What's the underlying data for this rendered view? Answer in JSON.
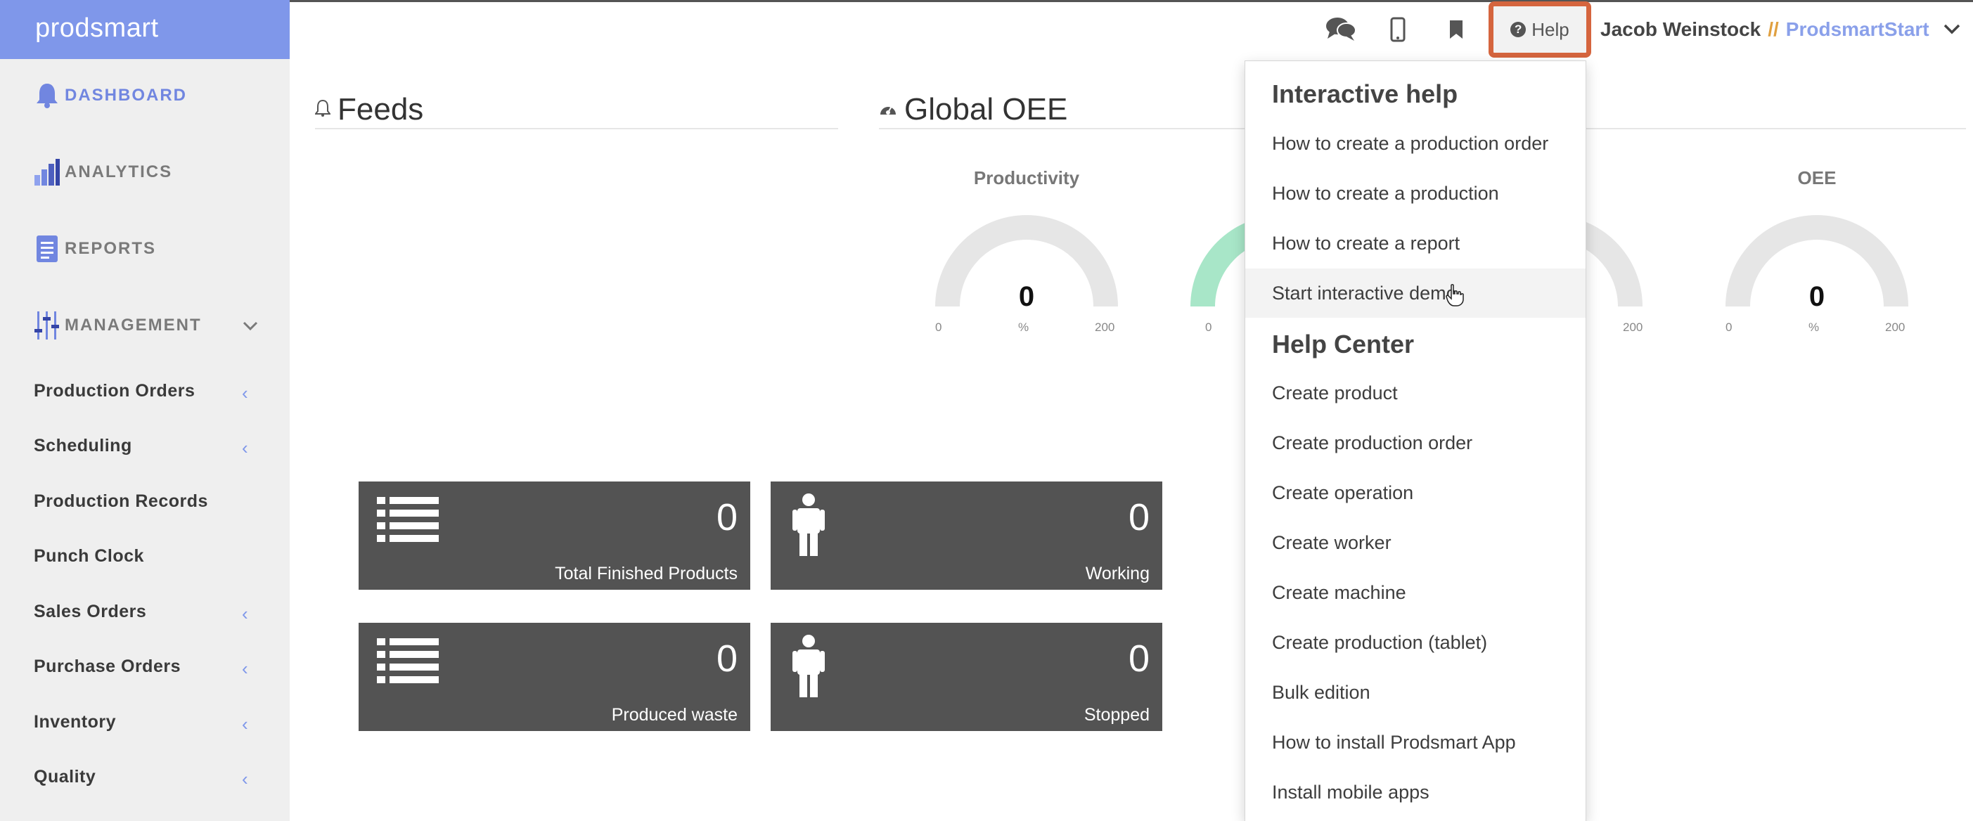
{
  "sidebar": {
    "brand": "prodsmart",
    "main_items": [
      {
        "label": "DASHBOARD",
        "icon": "bell-icon",
        "active": true
      },
      {
        "label": "ANALYTICS",
        "icon": "bar-chart-icon",
        "active": false
      },
      {
        "label": "REPORTS",
        "icon": "report-icon",
        "active": false
      },
      {
        "label": "MANAGEMENT",
        "icon": "sliders-icon",
        "active": false
      }
    ],
    "sub_items": [
      {
        "label": "Production Orders",
        "has_chevron": true
      },
      {
        "label": "Scheduling",
        "has_chevron": true
      },
      {
        "label": "Production Records",
        "has_chevron": false
      },
      {
        "label": "Punch Clock",
        "has_chevron": false
      },
      {
        "label": "Sales Orders",
        "has_chevron": true
      },
      {
        "label": "Purchase Orders",
        "has_chevron": true
      },
      {
        "label": "Inventory",
        "has_chevron": true
      },
      {
        "label": "Quality",
        "has_chevron": true
      }
    ]
  },
  "topbar": {
    "icons": [
      "chat-icon",
      "mobile-icon",
      "bookmark-icon"
    ],
    "help_label": "Help",
    "user_name": "Jacob Weinstock",
    "separator": "//",
    "company": "ProdsmartStart"
  },
  "feeds": {
    "title": "Feeds"
  },
  "oee": {
    "title": "Global OEE",
    "gauges": [
      {
        "title": "Productivity",
        "value": "0",
        "min": "0",
        "max": "200",
        "unit": "%"
      },
      {
        "title": "OEE",
        "value": "0",
        "min": "0",
        "max": "200",
        "unit": "%"
      }
    ],
    "partial": {
      "min": "0",
      "max_right": "200"
    }
  },
  "tiles": [
    {
      "value": "0",
      "label": "Total Finished Products",
      "icon": "list-icon"
    },
    {
      "value": "0",
      "label": "Working",
      "icon": "person-icon"
    },
    {
      "value": "0",
      "label": "Produced waste",
      "icon": "list-icon"
    },
    {
      "value": "0",
      "label": "Stopped",
      "icon": "person-icon"
    }
  ],
  "help_menu": {
    "interactive_title": "Interactive help",
    "interactive_items": [
      "How to create a production order",
      "How to create a production",
      "How to create a report",
      "Start interactive demo"
    ],
    "center_title": "Help Center",
    "center_items": [
      "Create product",
      "Create production order",
      "Create operation",
      "Create worker",
      "Create machine",
      "Create production (tablet)",
      "Bulk edition",
      "How to install Prodsmart App",
      "Install mobile apps"
    ]
  },
  "colors": {
    "brand": "#7f97ea",
    "sidebar_bg": "#efefef",
    "tile_bg": "#535353",
    "help_highlight": "#d5653e",
    "gauge_track": "#e6e6e6",
    "gauge_green": "#a8e6c8"
  }
}
